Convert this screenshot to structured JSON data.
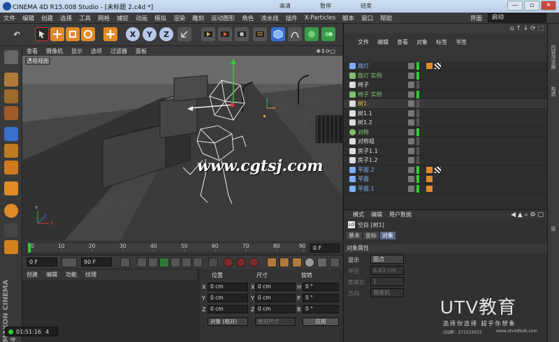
{
  "window": {
    "title": "CINEMA 4D R15.008 Studio - [未标题 2.c4d *]",
    "top_buttons": [
      "高清",
      "暂停",
      "结束"
    ],
    "controls": {
      "minimize": "—",
      "restore": "▫",
      "close": "✕"
    }
  },
  "menu": [
    "文件",
    "编辑",
    "创建",
    "选择",
    "工具",
    "网格",
    "捕捉",
    "动画",
    "模拟",
    "渲染",
    "雕刻",
    "运动图形",
    "角色",
    "流水线",
    "插件",
    "X-Particles",
    "脚本",
    "窗口",
    "帮助"
  ],
  "interface": {
    "label": "界面",
    "value": "启动"
  },
  "toolbar": {
    "icons": [
      "undo-icon",
      "select-live-icon",
      "move-icon",
      "scale-icon",
      "rotate-icon",
      "add-icon",
      "axis-x-icon",
      "axis-y-icon",
      "axis-z-icon",
      "coordinate-icon",
      "render-view-icon",
      "render-pic-icon",
      "render-settings-icon",
      "cube-icon",
      "pen-icon",
      "subdivision-icon",
      "array-icon",
      "deformer-icon",
      "scene-icon",
      "camera-icon",
      "light-icon"
    ],
    "axis_labels": [
      "X",
      "Y",
      "Z"
    ]
  },
  "viewport": {
    "menu": [
      "查看",
      "摄像机",
      "显示",
      "选项",
      "过滤器",
      "面板"
    ],
    "label": "透视视图",
    "watermark": "www.cgtsj.com",
    "axis_labels": [
      "Y",
      "X",
      "Z"
    ]
  },
  "timeline": {
    "ticks": [
      "0",
      "10",
      "20",
      "30",
      "40",
      "50",
      "60",
      "70",
      "80",
      "90"
    ],
    "frame_field": "0 F",
    "start_field": "0 F",
    "end_field": "90 F",
    "playhead": 0
  },
  "materials": {
    "menu": [
      "创建",
      "编辑",
      "功能",
      "纹理"
    ]
  },
  "coordinates": {
    "headers": [
      "位置",
      "尺寸",
      "旋转"
    ],
    "rows": [
      {
        "axis": "X",
        "pos": "0 cm",
        "size": "0 cm",
        "rot_label": "H",
        "rot": "0 °"
      },
      {
        "axis": "Y",
        "pos": "0 cm",
        "size": "0 cm",
        "rot_label": "P",
        "rot": "0 °"
      },
      {
        "axis": "Z",
        "pos": "0 cm",
        "size": "0 cm",
        "rot_label": "B",
        "rot": "0 °"
      }
    ],
    "mode_select": "对象 (相对)",
    "size_select": "绝对尺寸",
    "apply": "应用"
  },
  "objects": {
    "menu": [
      "文件",
      "编辑",
      "查看",
      "对象",
      "标签",
      "书签"
    ],
    "items": [
      {
        "name": "路灯",
        "icon": "lathe",
        "color": "#7bb0ff",
        "green": true,
        "tags": 2
      },
      {
        "name": "路灯 实例",
        "icon": "instance",
        "color": "#7ec06d",
        "green": true,
        "tags": 0
      },
      {
        "name": "椅子",
        "icon": "null",
        "color": "#ddd",
        "green": false,
        "tags": 0
      },
      {
        "name": "椅子 实例",
        "icon": "instance",
        "color": "#7ec06d",
        "green": true,
        "tags": 0
      },
      {
        "name": "树1",
        "icon": "null",
        "color": "#ffb347",
        "green": false,
        "tags": 0,
        "highlight": true
      },
      {
        "name": "树1.1",
        "icon": "null",
        "color": "#ddd",
        "green": false,
        "tags": 0
      },
      {
        "name": "树1.2",
        "icon": "null",
        "color": "#ddd",
        "green": false,
        "tags": 0
      },
      {
        "name": "对称",
        "icon": "symmetry",
        "color": "#7ec06d",
        "green": true,
        "tags": 0
      },
      {
        "name": "对称组",
        "icon": "null",
        "color": "#ddd",
        "green": false,
        "tags": 0
      },
      {
        "name": "房子1.1",
        "icon": "null",
        "color": "#ddd",
        "green": false,
        "tags": 0
      },
      {
        "name": "房子1.2",
        "icon": "null",
        "color": "#ddd",
        "green": false,
        "tags": 0
      },
      {
        "name": "平面.2",
        "icon": "plane",
        "color": "#7bb0ff",
        "green": true,
        "tags": 2
      },
      {
        "name": "平面",
        "icon": "plane",
        "color": "#7bb0ff",
        "green": true,
        "tags": 1
      },
      {
        "name": "平面.1",
        "icon": "plane",
        "color": "#7bb0ff",
        "green": true,
        "tags": 1
      }
    ]
  },
  "attributes": {
    "menu": [
      "模式",
      "编辑",
      "用户数据"
    ],
    "title": "空白 [树1]",
    "tabs": [
      "基本",
      "坐标",
      "对象"
    ],
    "section": "对象属性",
    "fields": [
      {
        "label": "显示",
        "value": "圆点"
      },
      {
        "label": "半径",
        "value": "6.63 cm"
      },
      {
        "label": "宽高比",
        "value": "1"
      },
      {
        "label": "方向",
        "value": "摄像机"
      }
    ]
  },
  "side_tabs": [
    "内容浏览器",
    "构造",
    "层"
  ],
  "brand": {
    "name": "UTV教育",
    "slogan": "选择你选择 超乎你想象",
    "qq": "QQ群：271519531",
    "site": "www.utv4dtalk.com"
  },
  "maxon_text": "MAXON CINEMA 4D",
  "status": {
    "time": "01:51:16",
    "extra": "4"
  }
}
